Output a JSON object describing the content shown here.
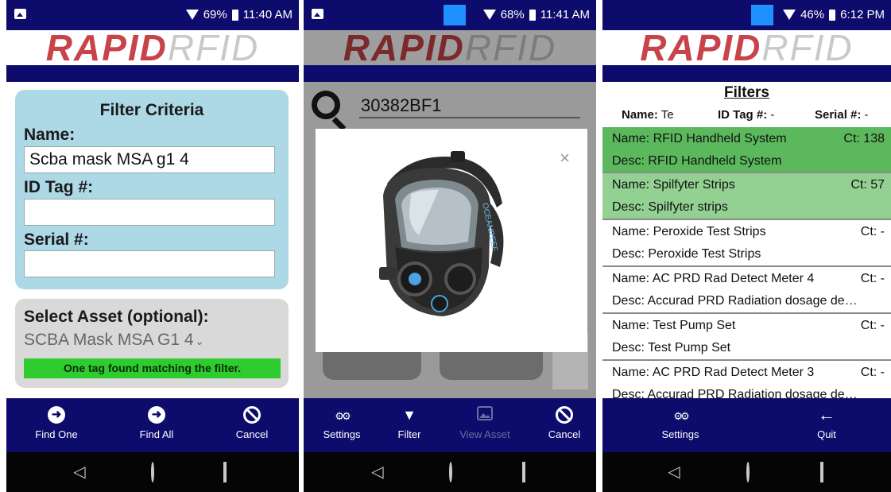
{
  "status": {
    "p1": {
      "battery": "69%",
      "time": "11:40 AM"
    },
    "p2": {
      "battery": "68%",
      "time": "11:41 AM"
    },
    "p3": {
      "battery": "46%",
      "time": "6:12 PM"
    }
  },
  "logo": {
    "rapid": "RAPID",
    "rfid": "RFID"
  },
  "screen1": {
    "title": "Filter Criteria",
    "name_label": "Name:",
    "name_value": "Scba mask MSA g1 4",
    "idtag_label": "ID Tag #:",
    "idtag_value": "",
    "serial_label": "Serial #:",
    "serial_value": "",
    "asset_label": "Select Asset (optional):",
    "asset_selected": "SCBA Mask MSA G1 4",
    "found_message": "One tag found matching the filter.",
    "bottom": {
      "find_one": "Find One",
      "find_all": "Find All",
      "cancel": "Cancel"
    }
  },
  "screen2": {
    "search_value": "30382BF1",
    "close_glyph": "×",
    "mask_text": "OCEANREEF",
    "bottom": {
      "settings": "Settings",
      "filter": "Filter",
      "view_asset": "View Asset",
      "cancel": "Cancel"
    }
  },
  "screen3": {
    "title": "Filters",
    "criteria": {
      "name_label": "Name:",
      "name_value": "Te",
      "idtag_label": "ID Tag #:",
      "idtag_value": "-",
      "serial_label": "Serial #:",
      "serial_value": "-"
    },
    "items": [
      {
        "name": "Name: RFID Handheld System",
        "ct": "Ct: 138",
        "desc": "Desc: RFID Handheld System"
      },
      {
        "name": "Name: Spilfyter Strips",
        "ct": "Ct: 57",
        "desc": "Desc: Spilfyter strips"
      },
      {
        "name": "Name: Peroxide Test Strips",
        "ct": "Ct: -",
        "desc": "Desc: Peroxide Test Strips"
      },
      {
        "name": "Name: AC PRD Rad Detect Meter 4",
        "ct": "Ct: -",
        "desc": "Desc: Accurad PRD Radiation dosage de…"
      },
      {
        "name": "Name: Test Pump Set",
        "ct": "Ct: -",
        "desc": "Desc: Test Pump Set"
      },
      {
        "name": "Name: AC PRD Rad Detect Meter 3",
        "ct": "Ct: -",
        "desc": "Desc: Accurad PRD Radiation dosage de…"
      }
    ],
    "bottom": {
      "settings": "Settings",
      "quit": "Quit"
    }
  },
  "nav": {
    "back": "◁",
    "home": "○",
    "recents": "□"
  },
  "icons": {
    "find_one": "arrow-circle-icon",
    "find_all": "arrow-circle-icon",
    "cancel": "ban-icon",
    "settings": "gears-icon",
    "filter": "funnel-icon",
    "view_asset": "image-icon",
    "quit": "arrow-left-icon",
    "search": "magnifier-icon",
    "close": "close-icon"
  },
  "colors": {
    "brand_navy": "#0d0b6b",
    "logo_red": "#c8434a",
    "logo_gray": "#c9c9c9",
    "filter_panel": "#add8e6",
    "asset_panel": "#d9d9d9",
    "found_green": "#2ecc2e",
    "row_selected_dark": "#5cb85c",
    "row_selected_light": "#92d192"
  }
}
